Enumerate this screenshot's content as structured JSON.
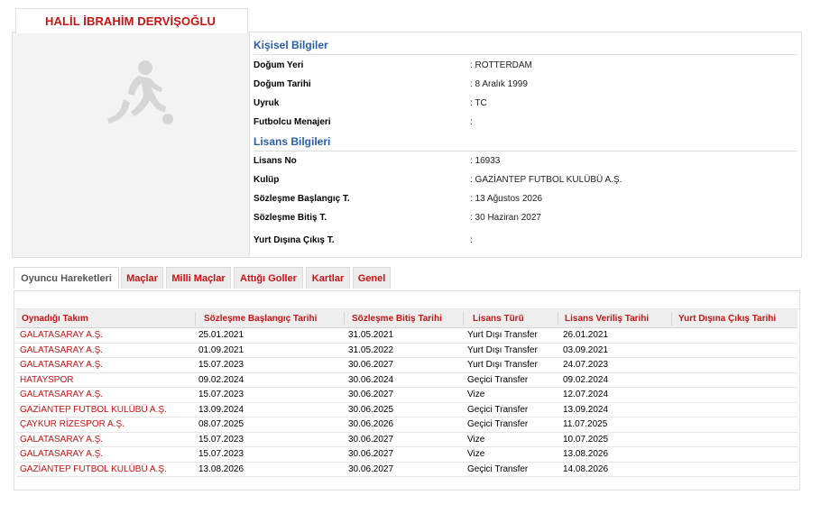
{
  "player": {
    "name": "HALİL İBRAHİM DERVİŞOĞLU"
  },
  "icons": {
    "photo": "footballer-silhouette-icon"
  },
  "personal": {
    "title": "Kişisel Bilgiler",
    "rows": [
      {
        "label": "Doğum Yeri",
        "value": ":  ROTTERDAM"
      },
      {
        "label": "Doğum Tarihi",
        "value": ":  8 Aralık 1999"
      },
      {
        "label": "Uyruk",
        "value": ":  TC"
      },
      {
        "label": "Futbolcu Menajeri",
        "value": ":"
      }
    ]
  },
  "license": {
    "title": "Lisans Bilgileri",
    "rows": [
      {
        "label": "Lisans No",
        "value": ": 16933"
      },
      {
        "label": "Kulüp",
        "value": ": GAZİANTEP FUTBOL KULÜBÜ A.Ş."
      },
      {
        "label": "Sözleşme Başlangıç T.",
        "value": ": 13 Ağustos 2026"
      },
      {
        "label": "Sözleşme Bitiş T.",
        "value": ": 30 Haziran 2027"
      },
      {
        "label": "Yurt Dışına Çıkış T.",
        "value": ":"
      }
    ]
  },
  "tabs": [
    {
      "label": "Oyuncu Hareketleri",
      "active": true
    },
    {
      "label": "Maçlar",
      "active": false
    },
    {
      "label": "Milli Maçlar",
      "active": false
    },
    {
      "label": "Attığı Goller",
      "active": false
    },
    {
      "label": "Kartlar",
      "active": false
    },
    {
      "label": "Genel",
      "active": false
    }
  ],
  "table": {
    "headers": [
      "Oynadığı Takım",
      "Sözleşme Başlangıç Tarihi",
      "Sözleşme Bitiş Tarihi",
      "Lisans Türü",
      "Lisans Veriliş Tarihi",
      "Yurt Dışına Çıkış Tarihi"
    ],
    "rows": [
      [
        "GALATASARAY A.Ş.",
        "25.01.2021",
        "31.05.2021",
        "Yurt Dışı Transfer",
        "26.01.2021",
        ""
      ],
      [
        "GALATASARAY A.Ş.",
        "01.09.2021",
        "31.05.2022",
        "Yurt Dışı Transfer",
        "03.09.2021",
        ""
      ],
      [
        "GALATASARAY A.Ş.",
        "15.07.2023",
        "30.06.2027",
        "Yurt Dışı Transfer",
        "24.07.2023",
        ""
      ],
      [
        "HATAYSPOR",
        "09.02.2024",
        "30.06.2024",
        "Geçici Transfer",
        "09.02.2024",
        ""
      ],
      [
        "GALATASARAY A.Ş.",
        "15.07.2023",
        "30.06.2027",
        "Vize",
        "12.07.2024",
        ""
      ],
      [
        "GAZİANTEP FUTBOL KULÜBÜ A.Ş.",
        "13.09.2024",
        "30.06.2025",
        "Geçici Transfer",
        "13.09.2024",
        ""
      ],
      [
        "ÇAYKUR RİZESPOR A.Ş.",
        "08.07.2025",
        "30.06.2026",
        "Geçici Transfer",
        "11.07.2025",
        ""
      ],
      [
        "GALATASARAY A.Ş.",
        "15.07.2023",
        "30.06.2027",
        "Vize",
        "10.07.2025",
        ""
      ],
      [
        "GALATASARAY A.Ş.",
        "15.07.2023",
        "30.06.2027",
        "Vize",
        "13.08.2026",
        ""
      ],
      [
        "GAZİANTEP FUTBOL KULÜBÜ A.Ş.",
        "13.08.2026",
        "30.06.2027",
        "Geçici Transfer",
        "14.08.2026",
        ""
      ]
    ]
  }
}
